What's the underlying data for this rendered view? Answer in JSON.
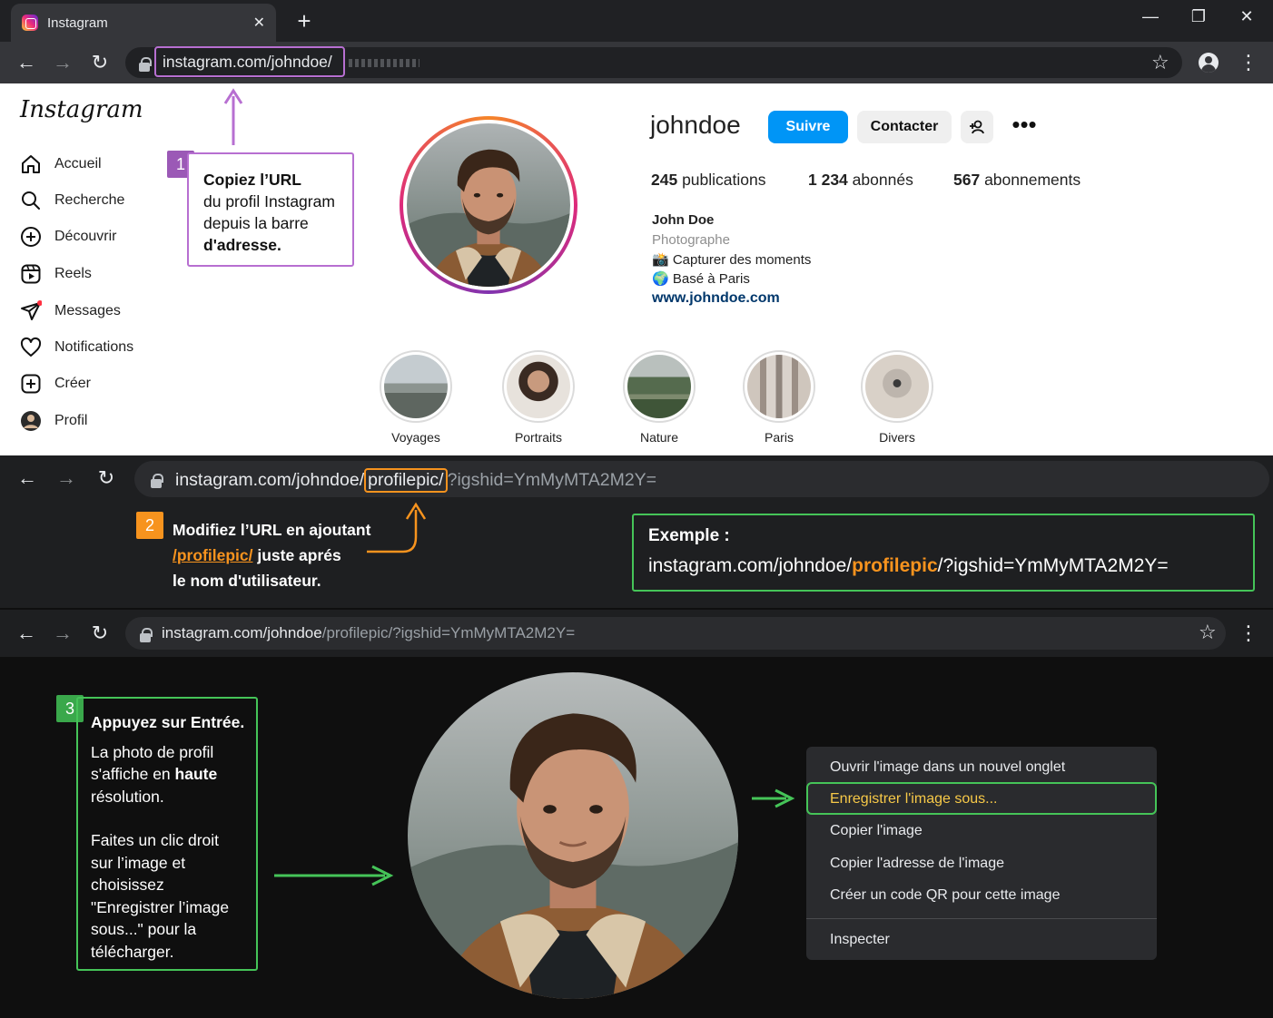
{
  "colors": {
    "accent_purple": "#b76fd1",
    "accent_orange": "#f7931e",
    "accent_green": "#45c458",
    "follow_blue": "#0095f6",
    "link_navy": "#00376b"
  },
  "browser": {
    "tab_title": "Instagram",
    "tab_close": "✕",
    "new_tab": "+",
    "win_min": "—",
    "win_max": "❐",
    "win_close": "✕",
    "back": "←",
    "forward": "→",
    "reload": "↻",
    "url_main": "instagram.com/johndoe/",
    "star": "☆",
    "menu": "⋮"
  },
  "instagram": {
    "logo": "Instagram",
    "nav": [
      {
        "label": "Accueil",
        "icon": "home-icon"
      },
      {
        "label": "Recherche",
        "icon": "search-icon"
      },
      {
        "label": "Découvrir",
        "icon": "explore-icon"
      },
      {
        "label": "Reels",
        "icon": "reels-icon"
      },
      {
        "label": "Messages",
        "icon": "messages-icon"
      },
      {
        "label": "Notifications",
        "icon": "heart-icon"
      },
      {
        "label": "Créer",
        "icon": "create-icon"
      },
      {
        "label": "Profil",
        "icon": "profile-icon"
      }
    ],
    "username": "johndoe",
    "follow": "Suivre",
    "contact": "Contacter",
    "more": "•••",
    "stats": {
      "posts_count": "245",
      "posts_label": "publications",
      "followers_count": "1 234",
      "followers_label": "abonnés",
      "following_count": "567",
      "following_label": "abonnements"
    },
    "bio": {
      "name": "John Doe",
      "category": "Photographe",
      "line1": "📸 Capturer des moments",
      "line2": "🌍 Basé à Paris",
      "website": "www.johndoe.com"
    },
    "highlights": [
      "Voyages",
      "Portraits",
      "Nature",
      "Paris",
      "Divers"
    ]
  },
  "step1": {
    "badge": "1",
    "title": "Copiez l’URL",
    "line1": "du profil Instagram",
    "line2": "depuis la barre",
    "line3": "d'adresse."
  },
  "step2": {
    "url_prefix": "instagram.com/johndoe/",
    "url_added": "profilepic/",
    "url_suffix": "?igshid=YmMyMTA2M2Y=",
    "badge": "2",
    "line1": "Modifiez l’URL en ajoutant",
    "line2_highlight": "/profilepic/",
    "line2_rest": " juste aprés",
    "line3": "le nom d'utilisateur.",
    "example_title": "Exemple :",
    "example_prefix": "instagram.com/johndoe/",
    "example_highlight": "profilepic",
    "example_suffix": "/?igshid=YmMyMTA2M2Y="
  },
  "step3": {
    "url_main": "instagram.com/johndoe",
    "url_rest": "/profilepic/?igshid=YmMyMTA2M2Y=",
    "badge": "3",
    "title": "Appuyez sur Entrée.",
    "p1_a": "La photo de profil",
    "p1_b_pre": "s'affiche en ",
    "p1_b_bold": "haute",
    "p1_c": "résolution.",
    "p2_a": "Faites un clic droit",
    "p2_b": "sur l’image et",
    "p2_c": "choisissez",
    "p2_d": "\"Enregistrer l’image",
    "p2_e": "sous...\" pour la",
    "p2_f": "télécharger."
  },
  "context_menu": {
    "items": [
      "Ouvrir l'image dans un nouvel onglet",
      "Enregistrer l'image sous...",
      "Copier l'image",
      "Copier l'adresse de l'image",
      "Créer un code QR pour cette image",
      "Inspecter"
    ],
    "highlighted_index": 1
  }
}
